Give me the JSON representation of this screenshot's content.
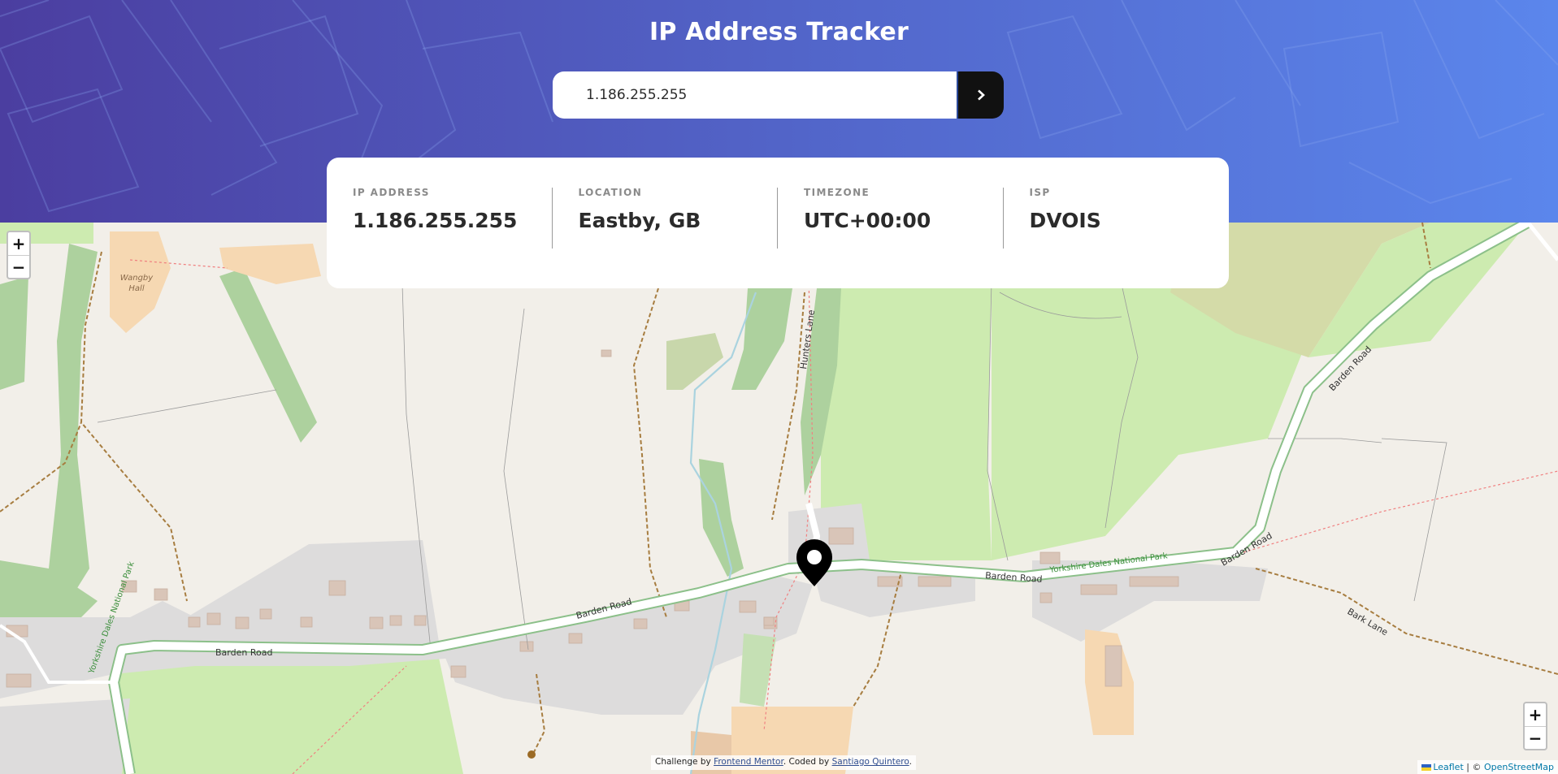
{
  "app": {
    "title": "IP Address Tracker"
  },
  "search": {
    "value": "1.186.255.255",
    "button_icon": "chevron-right-icon"
  },
  "info": {
    "ip": {
      "label": "IP ADDRESS",
      "value": "1.186.255.255"
    },
    "location": {
      "label": "LOCATION",
      "value": "Eastby, GB"
    },
    "timezone": {
      "label": "TIMEZONE",
      "value": "UTC+00:00"
    },
    "isp": {
      "label": "ISP",
      "value": "DVOIS"
    }
  },
  "map": {
    "zoom_in": "+",
    "zoom_out": "−",
    "labels": {
      "wangby_hall_1": "Wangby",
      "wangby_hall_2": "Hall",
      "hunters_lane": "Hunters Lane",
      "barden_road": "Barden Road",
      "yorkshire_dales": "Yorkshire Dales National Park",
      "bark_lane": "Bark Lane"
    },
    "marker_icon": "location-pin-icon"
  },
  "credit": {
    "prefix": "Challenge by ",
    "frontend_mentor": "Frontend Mentor",
    "middle": ". Coded by ",
    "author": "Santiago Quintero",
    "suffix": "."
  },
  "attribution": {
    "leaflet": "Leaflet",
    "separator": " | © ",
    "osm": "OpenStreetMap"
  },
  "colors": {
    "header_start": "#4b3ea0",
    "header_end": "#5b86ec",
    "button": "#111111",
    "map_bg": "#f2efe9"
  }
}
